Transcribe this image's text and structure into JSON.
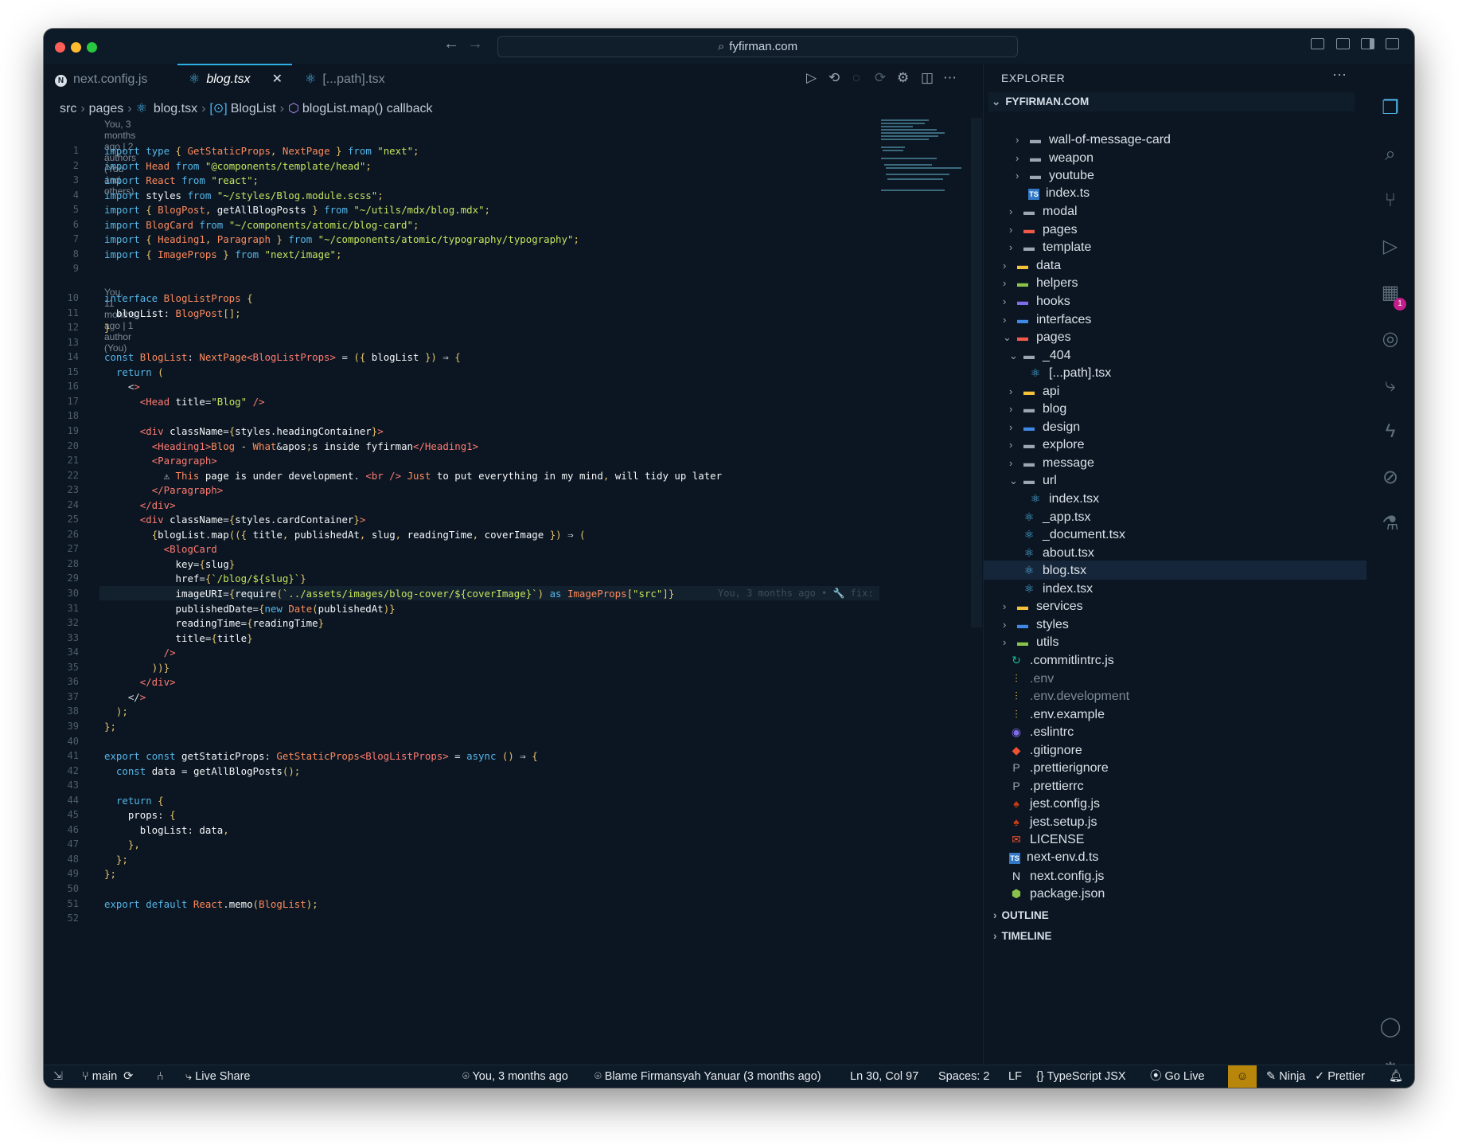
{
  "window": {
    "search_text": "fyfirman.com"
  },
  "tabs": [
    {
      "label": "next.config.js",
      "icon": "next-icon"
    },
    {
      "label": "blog.tsx",
      "icon": "react-icon",
      "active": true
    },
    {
      "label": "[...path].tsx",
      "icon": "react-icon"
    }
  ],
  "breadcrumb": [
    "src",
    "pages",
    "blog.tsx",
    "BlogList",
    "blogList.map() callback"
  ],
  "blame": {
    "top": "You, 3 months ago | 2 authors (You and others)",
    "line10": "You, 11 months ago | 1 author (You)",
    "inline30": "You, 3 months ago • 🔧 fix:"
  },
  "code_lines": [
    {
      "n": "1",
      "t": "import type { GetStaticProps, NextPage } from \"next\";"
    },
    {
      "n": "2",
      "t": "import Head from \"@components/template/head\";"
    },
    {
      "n": "3",
      "t": "import React from \"react\";"
    },
    {
      "n": "4",
      "t": "import styles from \"~/styles/Blog.module.scss\";"
    },
    {
      "n": "5",
      "t": "import { BlogPost, getAllBlogPosts } from \"~/utils/mdx/blog.mdx\";"
    },
    {
      "n": "6",
      "t": "import BlogCard from \"~/components/atomic/blog-card\";"
    },
    {
      "n": "7",
      "t": "import { Heading1, Paragraph } from \"~/components/atomic/typography/typography\";"
    },
    {
      "n": "8",
      "t": "import { ImageProps } from \"next/image\";"
    },
    {
      "n": "9",
      "t": ""
    },
    {
      "n": "10",
      "t": "interface BlogListProps {"
    },
    {
      "n": "11",
      "t": "  blogList: BlogPost[];"
    },
    {
      "n": "12",
      "t": "}"
    },
    {
      "n": "13",
      "t": ""
    },
    {
      "n": "14",
      "t": "const BlogList: NextPage<BlogListProps> = ({ blogList }) ⇒ {"
    },
    {
      "n": "15",
      "t": "  return ("
    },
    {
      "n": "16",
      "t": "    <>"
    },
    {
      "n": "17",
      "t": "      <Head title=\"Blog\" />"
    },
    {
      "n": "18",
      "t": ""
    },
    {
      "n": "19",
      "t": "      <div className={styles.headingContainer}>"
    },
    {
      "n": "20",
      "t": "        <Heading1>Blog - What&apos;s inside fyfirman</Heading1>"
    },
    {
      "n": "21",
      "t": "        <Paragraph>"
    },
    {
      "n": "22",
      "t": "          ⚠ This page is under development. <br /> Just to put everything in my mind, will tidy up later"
    },
    {
      "n": "23",
      "t": "        </Paragraph>"
    },
    {
      "n": "24",
      "t": "      </div>"
    },
    {
      "n": "25",
      "t": "      <div className={styles.cardContainer}>"
    },
    {
      "n": "26",
      "t": "        {blogList.map(({ title, publishedAt, slug, readingTime, coverImage }) ⇒ ("
    },
    {
      "n": "27",
      "t": "          <BlogCard"
    },
    {
      "n": "28",
      "t": "            key={slug}"
    },
    {
      "n": "29",
      "t": "            href={`/blog/${slug}`}"
    },
    {
      "n": "30",
      "t": "            imageURI={require(`../assets/images/blog-cover/${coverImage}`) as ImageProps[\"src\"]}"
    },
    {
      "n": "31",
      "t": "            publishedDate={new Date(publishedAt)}"
    },
    {
      "n": "32",
      "t": "            readingTime={readingTime}"
    },
    {
      "n": "33",
      "t": "            title={title}"
    },
    {
      "n": "34",
      "t": "          />"
    },
    {
      "n": "35",
      "t": "        ))}"
    },
    {
      "n": "36",
      "t": "      </div>"
    },
    {
      "n": "37",
      "t": "    </>"
    },
    {
      "n": "38",
      "t": "  );"
    },
    {
      "n": "39",
      "t": "};"
    },
    {
      "n": "40",
      "t": ""
    },
    {
      "n": "41",
      "t": "export const getStaticProps: GetStaticProps<BlogListProps> = async () ⇒ {"
    },
    {
      "n": "42",
      "t": "  const data = getAllBlogPosts();"
    },
    {
      "n": "43",
      "t": ""
    },
    {
      "n": "44",
      "t": "  return {"
    },
    {
      "n": "45",
      "t": "    props: {"
    },
    {
      "n": "46",
      "t": "      blogList: data,"
    },
    {
      "n": "47",
      "t": "    },"
    },
    {
      "n": "48",
      "t": "  };"
    },
    {
      "n": "49",
      "t": "};"
    },
    {
      "n": "50",
      "t": ""
    },
    {
      "n": "51",
      "t": "export default React.memo(BlogList);"
    },
    {
      "n": "52",
      "t": ""
    }
  ],
  "explorer": {
    "title": "EXPLORER",
    "root": "FYFIRMAN.COM",
    "items": [
      {
        "label": "wall-of-message-card",
        "indent": 4,
        "kind": "folder",
        "open": false
      },
      {
        "label": "weapon",
        "indent": 4,
        "kind": "folder",
        "open": false
      },
      {
        "label": "youtube",
        "indent": 4,
        "kind": "folder",
        "open": false
      },
      {
        "label": "index.ts",
        "indent": 4,
        "kind": "ts"
      },
      {
        "label": "modal",
        "indent": 3,
        "kind": "folder",
        "open": false
      },
      {
        "label": "pages",
        "indent": 3,
        "kind": "folder-red",
        "open": false
      },
      {
        "label": "template",
        "indent": 3,
        "kind": "folder",
        "open": false
      },
      {
        "label": "data",
        "indent": 2,
        "kind": "folder-yellow",
        "open": false
      },
      {
        "label": "helpers",
        "indent": 2,
        "kind": "folder-green",
        "open": false
      },
      {
        "label": "hooks",
        "indent": 2,
        "kind": "folder-purple",
        "open": false
      },
      {
        "label": "interfaces",
        "indent": 2,
        "kind": "folder-blue",
        "open": false
      },
      {
        "label": "pages",
        "indent": 2,
        "kind": "folder-red",
        "open": true
      },
      {
        "label": "_404",
        "indent": 3,
        "kind": "folder",
        "open": true
      },
      {
        "label": "[...path].tsx",
        "indent": 4,
        "kind": "react"
      },
      {
        "label": "api",
        "indent": 3,
        "kind": "folder-yellow",
        "open": false
      },
      {
        "label": "blog",
        "indent": 3,
        "kind": "folder",
        "open": false
      },
      {
        "label": "design",
        "indent": 3,
        "kind": "folder-blue",
        "open": false
      },
      {
        "label": "explore",
        "indent": 3,
        "kind": "folder",
        "open": false
      },
      {
        "label": "message",
        "indent": 3,
        "kind": "folder",
        "open": false
      },
      {
        "label": "url",
        "indent": 3,
        "kind": "folder",
        "open": true
      },
      {
        "label": "index.tsx",
        "indent": 4,
        "kind": "react"
      },
      {
        "label": "_app.tsx",
        "indent": 3,
        "kind": "react"
      },
      {
        "label": "_document.tsx",
        "indent": 3,
        "kind": "react"
      },
      {
        "label": "about.tsx",
        "indent": 3,
        "kind": "react"
      },
      {
        "label": "blog.tsx",
        "indent": 3,
        "kind": "react",
        "selected": true
      },
      {
        "label": "index.tsx",
        "indent": 3,
        "kind": "react"
      },
      {
        "label": "services",
        "indent": 2,
        "kind": "folder-yellow",
        "open": false
      },
      {
        "label": "styles",
        "indent": 2,
        "kind": "folder-blue",
        "open": false
      },
      {
        "label": "utils",
        "indent": 2,
        "kind": "folder-green",
        "open": false
      },
      {
        "label": ".commitlintrc.js",
        "indent": 1,
        "kind": "commitlint"
      },
      {
        "label": ".env",
        "indent": 1,
        "kind": "env",
        "dim": true
      },
      {
        "label": ".env.development",
        "indent": 1,
        "kind": "env",
        "dim": true
      },
      {
        "label": ".env.example",
        "indent": 1,
        "kind": "env"
      },
      {
        "label": ".eslintrc",
        "indent": 1,
        "kind": "eslint"
      },
      {
        "label": ".gitignore",
        "indent": 1,
        "kind": "git"
      },
      {
        "label": ".prettierignore",
        "indent": 1,
        "kind": "prettier"
      },
      {
        "label": ".prettierrc",
        "indent": 1,
        "kind": "prettier"
      },
      {
        "label": "jest.config.js",
        "indent": 1,
        "kind": "jest"
      },
      {
        "label": "jest.setup.js",
        "indent": 1,
        "kind": "jest"
      },
      {
        "label": "LICENSE",
        "indent": 1,
        "kind": "license"
      },
      {
        "label": "next-env.d.ts",
        "indent": 1,
        "kind": "ts"
      },
      {
        "label": "next.config.js",
        "indent": 1,
        "kind": "next"
      },
      {
        "label": "package.json",
        "indent": 1,
        "kind": "node"
      }
    ],
    "outline": "OUTLINE",
    "timeline": "TIMELINE"
  },
  "activity": {
    "extensions_badge": "1"
  },
  "status": {
    "branch": "main",
    "live_share": "Live Share",
    "blame": "You, 3 months ago",
    "blame_full": "Blame Firmansyah Yanuar (3 months ago)",
    "position": "Ln 30, Col 97",
    "spaces": "Spaces: 2",
    "eol": "LF",
    "language": "TypeScript JSX",
    "go_live": "Go Live",
    "ninja": "Ninja",
    "prettier": "Prettier"
  },
  "colors": {
    "accent": "#2bb0e4",
    "background": "#0b1622",
    "badge": "#c21f8a"
  }
}
